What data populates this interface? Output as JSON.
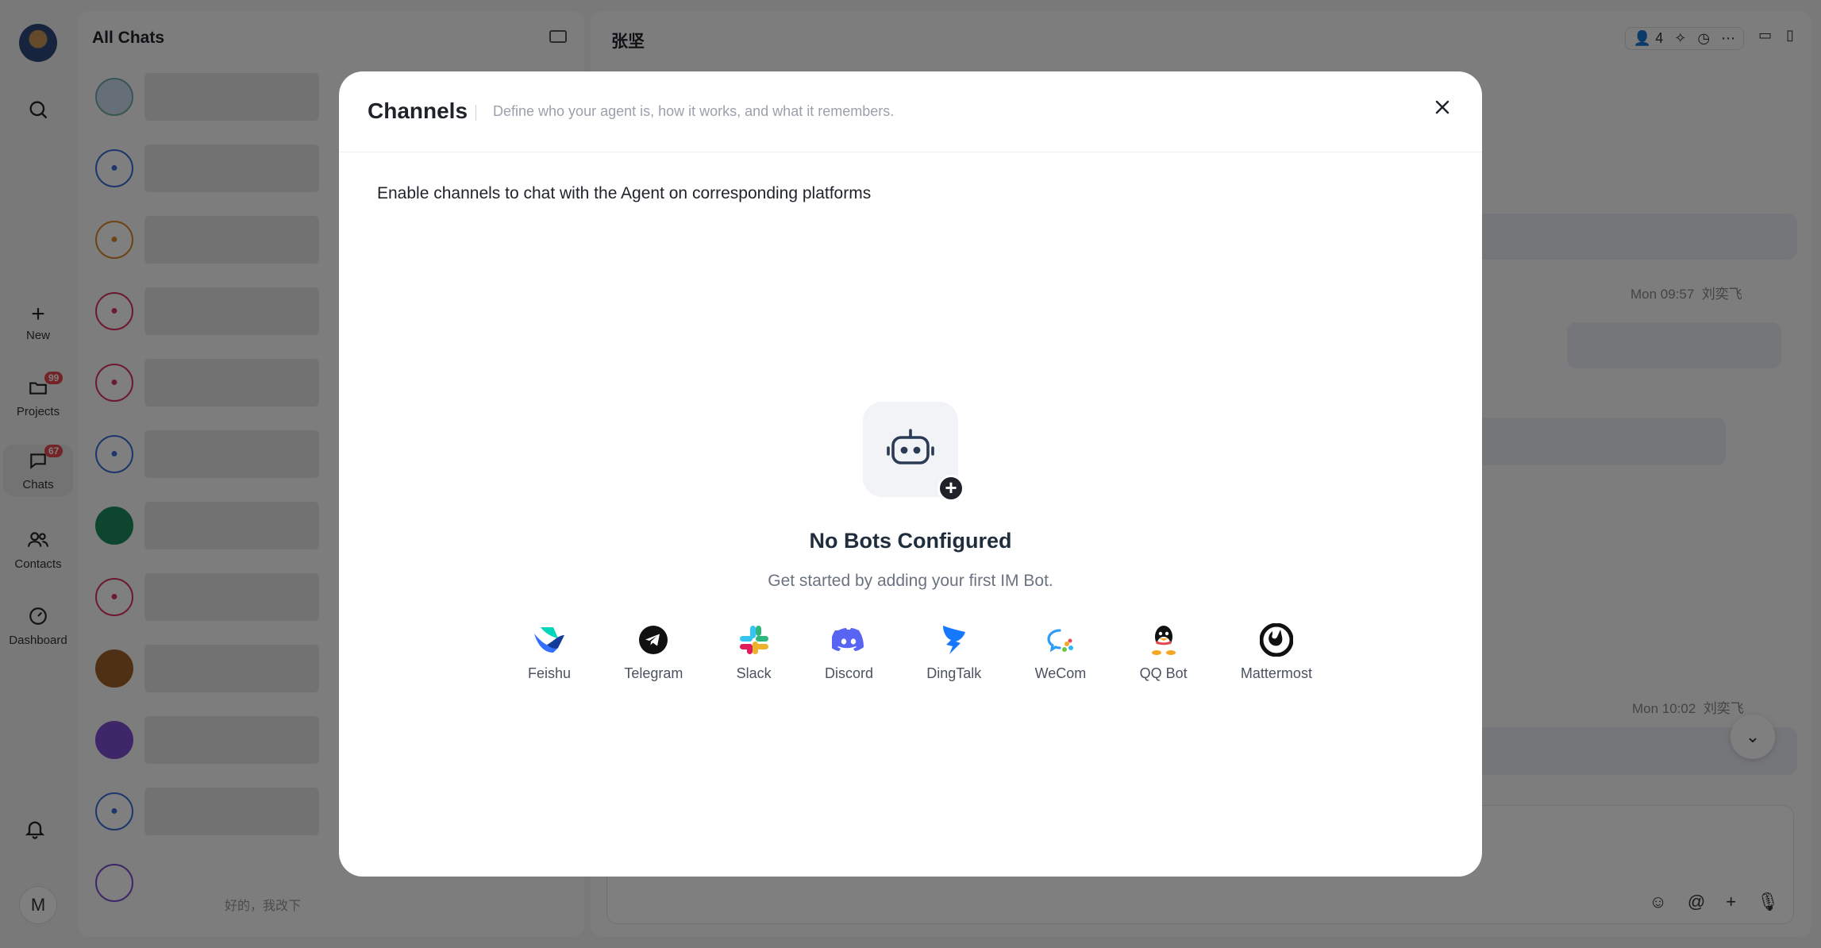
{
  "sidebar": {
    "items": [
      {
        "id": "search",
        "label": ""
      },
      {
        "id": "new",
        "label": "New"
      },
      {
        "id": "projects",
        "label": "Projects",
        "badge": "99"
      },
      {
        "id": "chats",
        "label": "Chats",
        "badge": "67"
      },
      {
        "id": "contacts",
        "label": "Contacts"
      },
      {
        "id": "dashboard",
        "label": "Dashboard"
      }
    ],
    "user_initial": "M"
  },
  "chat_list": {
    "title": "All Chats",
    "last_preview": "好的，我改下"
  },
  "conversation": {
    "title": "张坚",
    "member_count": "4",
    "messages": [
      {
        "time": "Mon 09:57",
        "sender": "刘奕飞"
      },
      {
        "time": "Mon 10:02",
        "sender": "刘奕飞"
      }
    ]
  },
  "modal": {
    "title": "Channels",
    "subtitle": "Define who your agent is, how it works, and what it remembers.",
    "intro": "Enable channels to chat with the Agent on corresponding platforms",
    "empty_title": "No Bots Configured",
    "empty_subtitle": "Get started by adding your first IM Bot.",
    "channels": [
      {
        "name": "Feishu",
        "icon": "feishu-icon",
        "color": "#3370ff"
      },
      {
        "name": "Telegram",
        "icon": "telegram-icon",
        "color": "#000000"
      },
      {
        "name": "Slack",
        "icon": "slack-icon",
        "color": "#e01e5a"
      },
      {
        "name": "Discord",
        "icon": "discord-icon",
        "color": "#5865f2"
      },
      {
        "name": "DingTalk",
        "icon": "dingtalk-icon",
        "color": "#1677ff"
      },
      {
        "name": "WeCom",
        "icon": "wecom-icon",
        "color": "#2f9cf4"
      },
      {
        "name": "QQ Bot",
        "icon": "qq-icon",
        "color": "#000000"
      },
      {
        "name": "Mattermost",
        "icon": "mattermost-icon",
        "color": "#1e1e1e"
      }
    ]
  }
}
